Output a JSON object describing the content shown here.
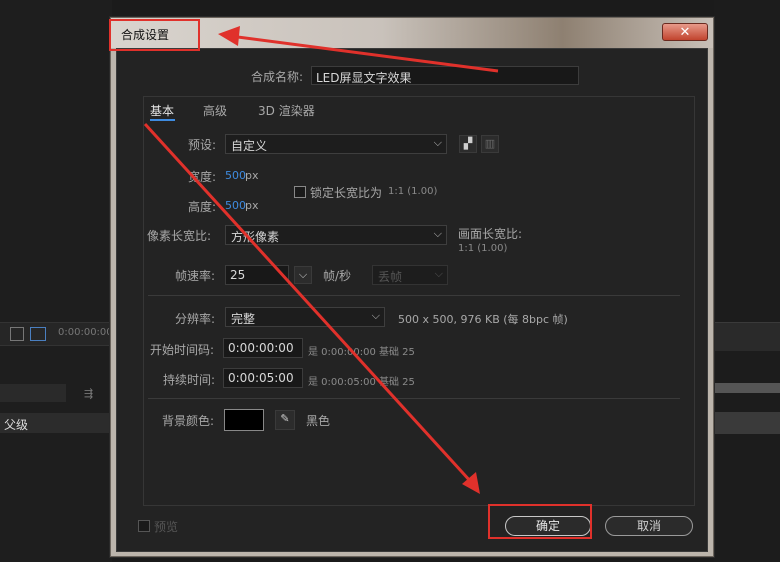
{
  "dialog": {
    "title": "合成设置",
    "close_glyph": "✕",
    "comp_name_label": "合成名称:",
    "comp_name_value": "LED屏显文字效果",
    "tabs": [
      "基本",
      "高级",
      "3D 渲染器"
    ],
    "preset_label": "预设:",
    "preset_value": "自定义",
    "width_label": "宽度:",
    "width_value": "500",
    "height_label": "高度:",
    "height_value": "500",
    "px_unit": "px",
    "lock_aspect_label": "锁定长宽比为",
    "lock_aspect_value": "1:1 (1.00)",
    "pixel_aspect_label": "像素长宽比:",
    "pixel_aspect_value": "方形像素",
    "frame_aspect_label": "画面长宽比:",
    "frame_aspect_value": "1:1 (1.00)",
    "frame_rate_label": "帧速率:",
    "frame_rate_value": "25",
    "fps_unit": "帧/秒",
    "drop_frame_value": "丢帧",
    "resolution_label": "分辨率:",
    "resolution_value": "完整",
    "resolution_info": "500 x 500, 976 KB (每 8bpc 帧)",
    "start_tc_label": "开始时间码:",
    "start_tc_value": "0:00:00:00",
    "start_tc_info": "是 0:00:00:00  基础 25",
    "duration_label": "持续时间:",
    "duration_value": "0:00:05:00",
    "duration_info": "是 0:00:05:00  基础 25",
    "bg_color_label": "背景颜色:",
    "bg_color_name": "黑色",
    "bg_color_swatch": "#000000",
    "preview_label": "预览",
    "ok_label": "确定",
    "cancel_label": "取消"
  },
  "background": {
    "timecode": "0:00:00:00",
    "parent_label": "父级"
  },
  "colors": {
    "annotation": "#e0312b",
    "accent_value": "#3e8be0"
  }
}
